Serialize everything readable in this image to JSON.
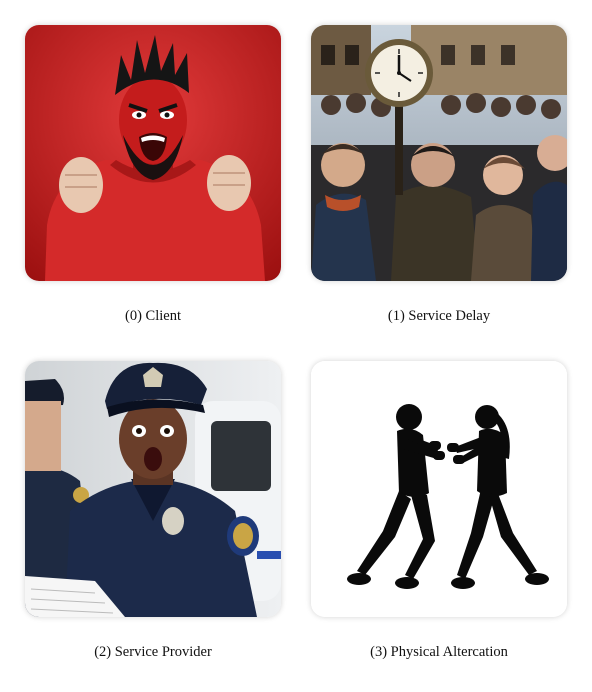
{
  "panels": [
    {
      "caption": "(0) Client"
    },
    {
      "caption": "(1) Service Delay"
    },
    {
      "caption": "(2) Service Provider"
    },
    {
      "caption": "(3) Physical Altercation"
    }
  ],
  "colors": {
    "client_background": "#c81e1e",
    "client_shirt": "#d42a2a",
    "crowd_sky": "#aebccb",
    "officer_uniform": "#1c2a4a",
    "silhouette": "#0a0a0a"
  }
}
